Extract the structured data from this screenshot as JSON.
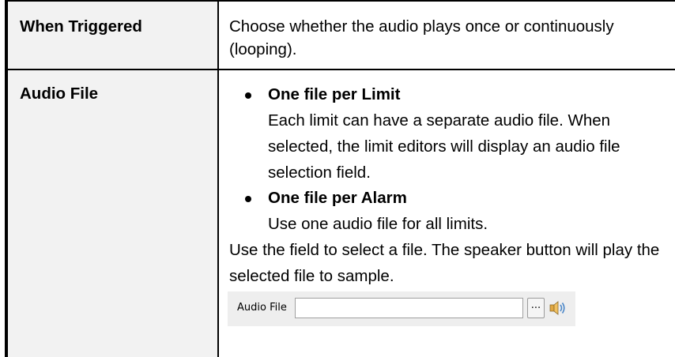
{
  "rows": [
    {
      "label": "When Triggered",
      "description": "Choose whether the audio plays once or continuously (looping)."
    },
    {
      "label": "Audio File",
      "bullets": [
        {
          "title": "One file per Limit",
          "text": "Each limit can have a separate audio file. When selected, the limit editors will display an audio file selection field."
        },
        {
          "title": "One file per Alarm",
          "text": "Use one audio file for all limits."
        }
      ],
      "usage": "Use the field to select a file. The speaker button will play the selected file to sample.",
      "field": {
        "label": "Audio File",
        "value": "",
        "browse_label": "...",
        "speaker_icon": "speaker-icon"
      }
    }
  ]
}
